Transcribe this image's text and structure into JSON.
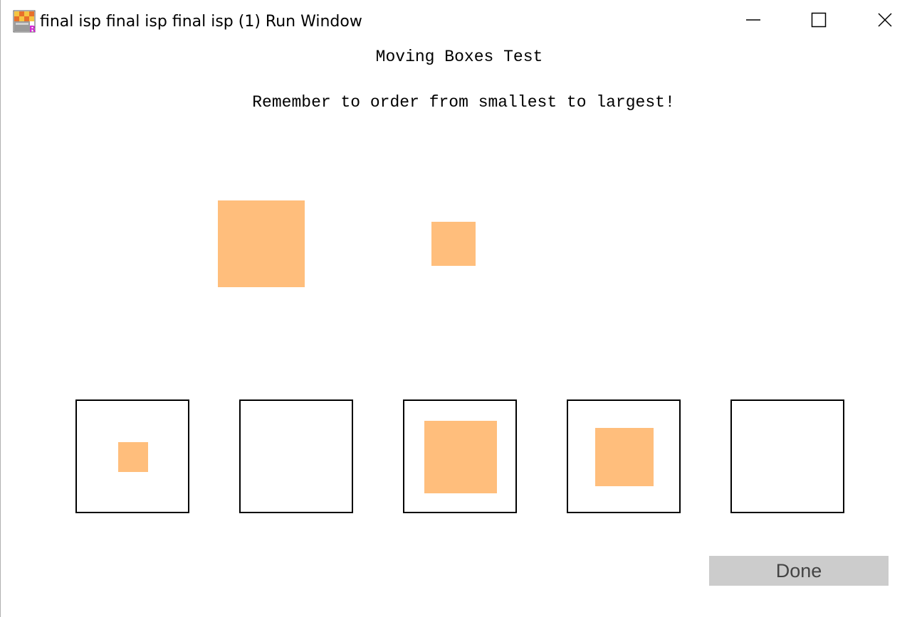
{
  "window": {
    "title": "final isp final isp final isp (1) Run Window",
    "icon": "run-window-app-icon",
    "controls": [
      "minimize-icon",
      "maximize-icon",
      "close-icon"
    ]
  },
  "content": {
    "heading": "Moving Boxes Test",
    "instruction": "Remember to order from smallest to largest!"
  },
  "colors": {
    "box": "#ffbe7c",
    "slot_border": "#000000",
    "done_button_bg": "#cccccc",
    "done_button_text": "#444444"
  },
  "done_button": {
    "label": "Done"
  }
}
